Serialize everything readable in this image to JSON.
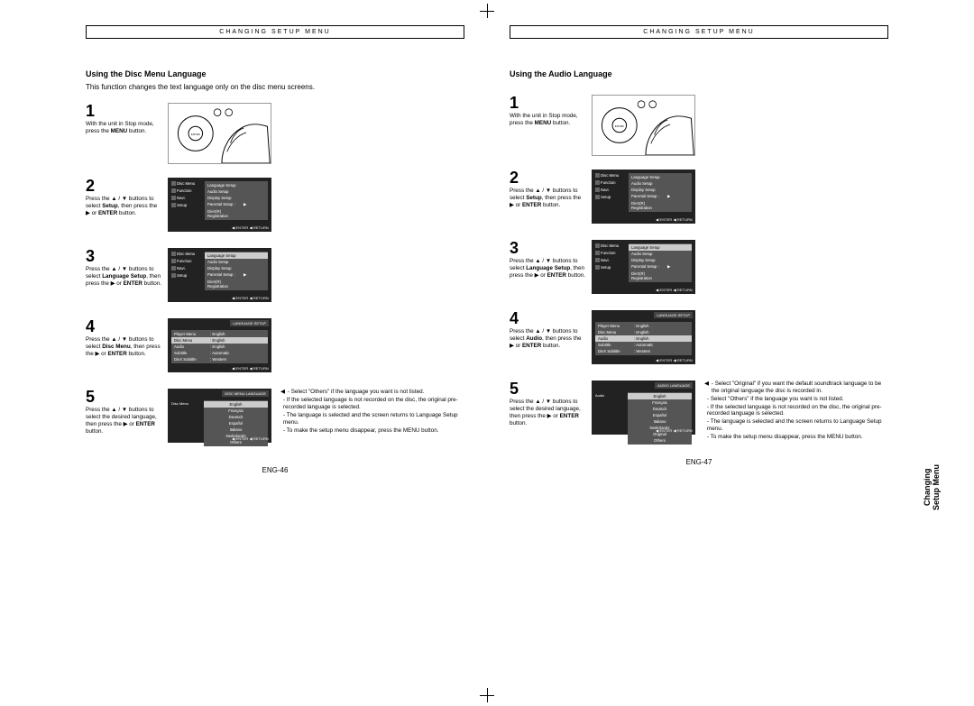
{
  "header": "CHANGING SETUP MENU",
  "left": {
    "title": "Using the Disc Menu Language",
    "subtitle": "This function changes the text language only on the disc menu screens.",
    "steps": [
      {
        "n": "1",
        "text": "With the unit in Stop mode, press the <b>MENU</b> button."
      },
      {
        "n": "2",
        "text": "Press the ▲ / ▼ buttons to select <b>Setup</b>, then press the ▶ or <b>ENTER</b> button."
      },
      {
        "n": "3",
        "text": "Press the ▲ / ▼ buttons to select <b>Language Setup</b>, then press the ▶ or <b>ENTER</b> button."
      },
      {
        "n": "4",
        "text": "Press the ▲ / ▼ buttons to select <b>Disc Menu</b>, then press the ▶ or <b>ENTER</b> button."
      },
      {
        "n": "5",
        "text": "Press the ▲ / ▼ buttons to select the desired language, then press the ▶ or <b>ENTER</b> button."
      }
    ],
    "side_menu": [
      "Disc Menu",
      "Function",
      "Navi.",
      "Setup"
    ],
    "setup_panel": [
      "Language Setup",
      "Audio Setup",
      "Display Setup",
      "Parental Setup :",
      "DivX(R) Registration"
    ],
    "lang_panel": [
      {
        "l": "Player Menu",
        "r": ": English"
      },
      {
        "l": "Disc Menu",
        "r": ": English",
        "hl": true
      },
      {
        "l": "Audio",
        "r": ": English"
      },
      {
        "l": "Subtitle",
        "r": ": Automatic"
      },
      {
        "l": "DivX Subtitle",
        "r": ": Western"
      }
    ],
    "panel_title_4": "LANGUAGE SETUP",
    "panel_title_5": "DISC MENU LANGUAGE",
    "langlist": [
      "English",
      "Français",
      "Deutsch",
      "Español",
      "Italiano",
      "Nederlands",
      "Others"
    ],
    "langlist_label": "Disc Menu",
    "footer": "◀ ENTER   ◀ RETURN",
    "notes": [
      "◀ - Select \"Others\" if the language you want is not listed.",
      "   - If the selected language is not recorded on the disc, the original pre-recorded language is selected.",
      "   - The language is selected and the screen returns to Language Setup menu.",
      "   - To make the setup menu disappear, press the MENU button."
    ],
    "pagenum": "ENG-46"
  },
  "right": {
    "title": "Using the Audio Language",
    "steps": [
      {
        "n": "1",
        "text": "With the unit in Stop mode, press the <b>MENU</b> button."
      },
      {
        "n": "2",
        "text": "Press the ▲ / ▼ buttons to select <b>Setup</b>, then press the ▶ or <b>ENTER</b> button."
      },
      {
        "n": "3",
        "text": "Press the ▲ / ▼ buttons to select <b>Language Setup</b>, then press the ▶ or <b>ENTER</b> button."
      },
      {
        "n": "4",
        "text": "Press the ▲ / ▼ buttons to select <b>Audio</b>, then press the ▶ or <b>ENTER</b> button."
      },
      {
        "n": "5",
        "text": "Press the ▲ / ▼ buttons to select the desired language, then press the ▶ or <b>ENTER</b> button."
      }
    ],
    "lang_panel": [
      {
        "l": "Player Menu",
        "r": ": English"
      },
      {
        "l": "Disc Menu",
        "r": ": English"
      },
      {
        "l": "Audio",
        "r": ": English",
        "hl": true
      },
      {
        "l": "Subtitle",
        "r": ": Automatic"
      },
      {
        "l": "DivX Subtitle",
        "r": ": Western"
      }
    ],
    "panel_title_4": "LANGUAGE SETUP",
    "panel_title_5": "AUDIO LANGUAGE",
    "langlist": [
      "English",
      "Français",
      "Deutsch",
      "Español",
      "Italiano",
      "Nederlands",
      "Original",
      "Others"
    ],
    "langlist_label": "Audio",
    "notes": [
      "◀ - Select \"Original\" if you want the default soundtrack language to be the original language the disc is recorded in.",
      "   - Select \"Others\" if the language you want is not listed.",
      "   - If the selected language is not recorded on the disc, the original pre-recorded language is selected.",
      "   - The language is selected and the screen returns to Language Setup menu.",
      "   - To make the setup menu disappear, press the MENU button."
    ],
    "pagenum": "ENG-47"
  },
  "sidetab": {
    "l1": "Changing",
    "l2": "Setup Menu"
  }
}
